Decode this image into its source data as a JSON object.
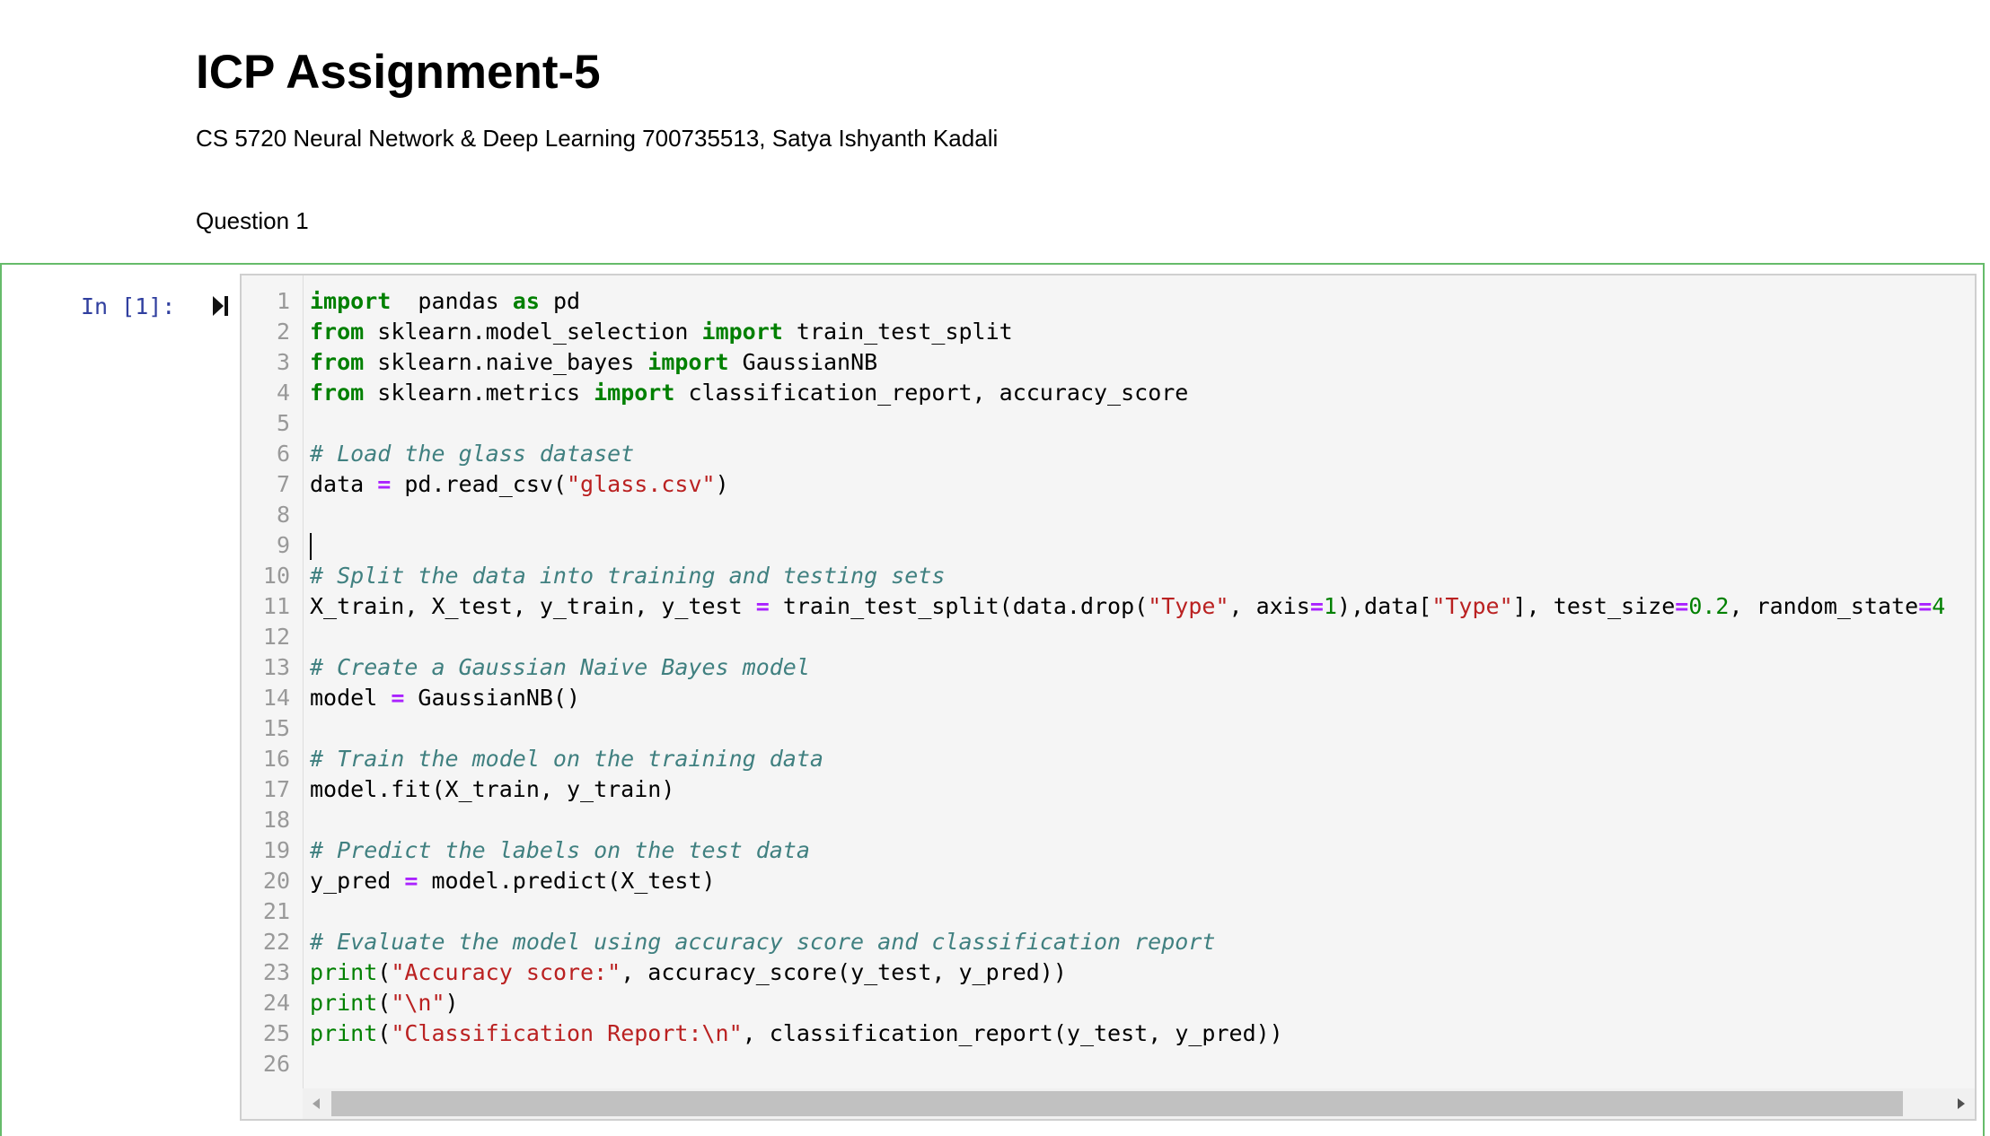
{
  "notebook": {
    "title": "ICP Assignment-5",
    "subtitle": "CS 5720 Neural Network & Deep Learning 700735513, Satya Ishyanth Kadali",
    "question": "Question 1"
  },
  "cell": {
    "prompt": "In [1]:",
    "run_icon": "run-cell-icon",
    "lines": [
      {
        "n": "1",
        "tokens": [
          [
            "kw",
            "import"
          ],
          [
            "",
            "  pandas "
          ],
          [
            "kw",
            "as"
          ],
          [
            "",
            " pd"
          ]
        ]
      },
      {
        "n": "2",
        "tokens": [
          [
            "kw",
            "from"
          ],
          [
            "",
            " sklearn.model_selection "
          ],
          [
            "kw",
            "import"
          ],
          [
            "",
            " train_test_split"
          ]
        ]
      },
      {
        "n": "3",
        "tokens": [
          [
            "kw",
            "from"
          ],
          [
            "",
            " sklearn.naive_bayes "
          ],
          [
            "kw",
            "import"
          ],
          [
            "",
            " GaussianNB"
          ]
        ]
      },
      {
        "n": "4",
        "tokens": [
          [
            "kw",
            "from"
          ],
          [
            "",
            " sklearn.metrics "
          ],
          [
            "kw",
            "import"
          ],
          [
            "",
            " classification_report, accuracy_score"
          ]
        ]
      },
      {
        "n": "5",
        "tokens": []
      },
      {
        "n": "6",
        "tokens": [
          [
            "cm",
            "# Load the glass dataset"
          ]
        ]
      },
      {
        "n": "7",
        "tokens": [
          [
            "",
            "data "
          ],
          [
            "op",
            "="
          ],
          [
            "",
            " pd.read_csv("
          ],
          [
            "str",
            "\"glass.csv\""
          ],
          [
            "",
            ")"
          ]
        ]
      },
      {
        "n": "8",
        "tokens": []
      },
      {
        "n": "9",
        "tokens": [],
        "cursor": true
      },
      {
        "n": "10",
        "tokens": [
          [
            "cm",
            "# Split the data into training and testing sets"
          ]
        ]
      },
      {
        "n": "11",
        "tokens": [
          [
            "",
            "X_train, X_test, y_train, y_test "
          ],
          [
            "op",
            "="
          ],
          [
            "",
            " train_test_split(data.drop("
          ],
          [
            "str",
            "\"Type\""
          ],
          [
            "",
            ", axis"
          ],
          [
            "op",
            "="
          ],
          [
            "num",
            "1"
          ],
          [
            "",
            "),data["
          ],
          [
            "str",
            "\"Type\""
          ],
          [
            "",
            "], test_size"
          ],
          [
            "op",
            "="
          ],
          [
            "num",
            "0.2"
          ],
          [
            "",
            ", random_state"
          ],
          [
            "op",
            "="
          ],
          [
            "num",
            "4"
          ]
        ]
      },
      {
        "n": "12",
        "tokens": []
      },
      {
        "n": "13",
        "tokens": [
          [
            "cm",
            "# Create a Gaussian Naive Bayes model"
          ]
        ]
      },
      {
        "n": "14",
        "tokens": [
          [
            "",
            "model "
          ],
          [
            "op",
            "="
          ],
          [
            "",
            " GaussianNB()"
          ]
        ]
      },
      {
        "n": "15",
        "tokens": []
      },
      {
        "n": "16",
        "tokens": [
          [
            "cm",
            "# Train the model on the training data"
          ]
        ]
      },
      {
        "n": "17",
        "tokens": [
          [
            "",
            "model.fit(X_train, y_train)"
          ]
        ]
      },
      {
        "n": "18",
        "tokens": []
      },
      {
        "n": "19",
        "tokens": [
          [
            "cm",
            "# Predict the labels on the test data"
          ]
        ]
      },
      {
        "n": "20",
        "tokens": [
          [
            "",
            "y_pred "
          ],
          [
            "op",
            "="
          ],
          [
            "",
            " model.predict(X_test)"
          ]
        ]
      },
      {
        "n": "21",
        "tokens": []
      },
      {
        "n": "22",
        "tokens": [
          [
            "cm",
            "# Evaluate the model using accuracy score and classification report"
          ]
        ]
      },
      {
        "n": "23",
        "tokens": [
          [
            "bi",
            "print"
          ],
          [
            "",
            "("
          ],
          [
            "str",
            "\"Accuracy score:\""
          ],
          [
            "",
            ", accuracy_score(y_test, y_pred))"
          ]
        ]
      },
      {
        "n": "24",
        "tokens": [
          [
            "bi",
            "print"
          ],
          [
            "",
            "("
          ],
          [
            "str",
            "\"\\n\""
          ],
          [
            "",
            ")"
          ]
        ]
      },
      {
        "n": "25",
        "tokens": [
          [
            "bi",
            "print"
          ],
          [
            "",
            "("
          ],
          [
            "str",
            "\"Classification Report:\\n\""
          ],
          [
            "",
            ", classification_report(y_test, y_pred))"
          ]
        ]
      },
      {
        "n": "26",
        "tokens": []
      }
    ]
  },
  "scrollbar": {
    "left_icon": "scroll-left-icon",
    "right_icon": "scroll-right-icon"
  },
  "colors": {
    "keyword": "#008000",
    "operator": "#aa22ff",
    "string": "#ba2121",
    "comment": "#408080",
    "prompt": "#303f9f",
    "cell_border": "#66bb6a"
  }
}
